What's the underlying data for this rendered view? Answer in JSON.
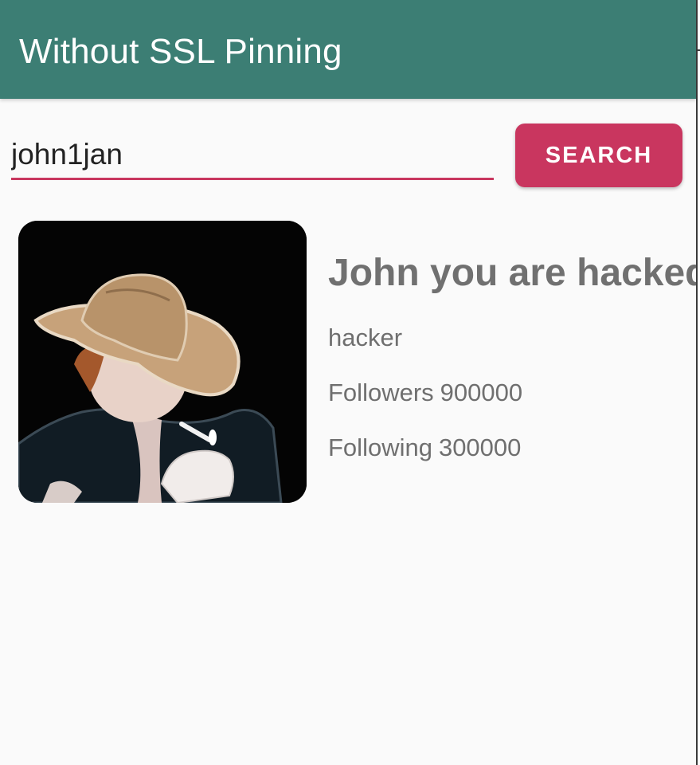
{
  "appbar": {
    "title": "Without SSL Pinning",
    "color": "#3c7e74"
  },
  "search": {
    "value": "john1jan",
    "underline_color": "#c8375f",
    "button_label": "SEARCH",
    "button_color": "#c9365f"
  },
  "profile": {
    "avatar_icon": "profile-photo-cowboy-hat",
    "name": "John you are hacked",
    "bio": "hacker",
    "followers_label": "Followers",
    "followers_count": "900000",
    "following_label": "Following",
    "following_count": "300000"
  }
}
